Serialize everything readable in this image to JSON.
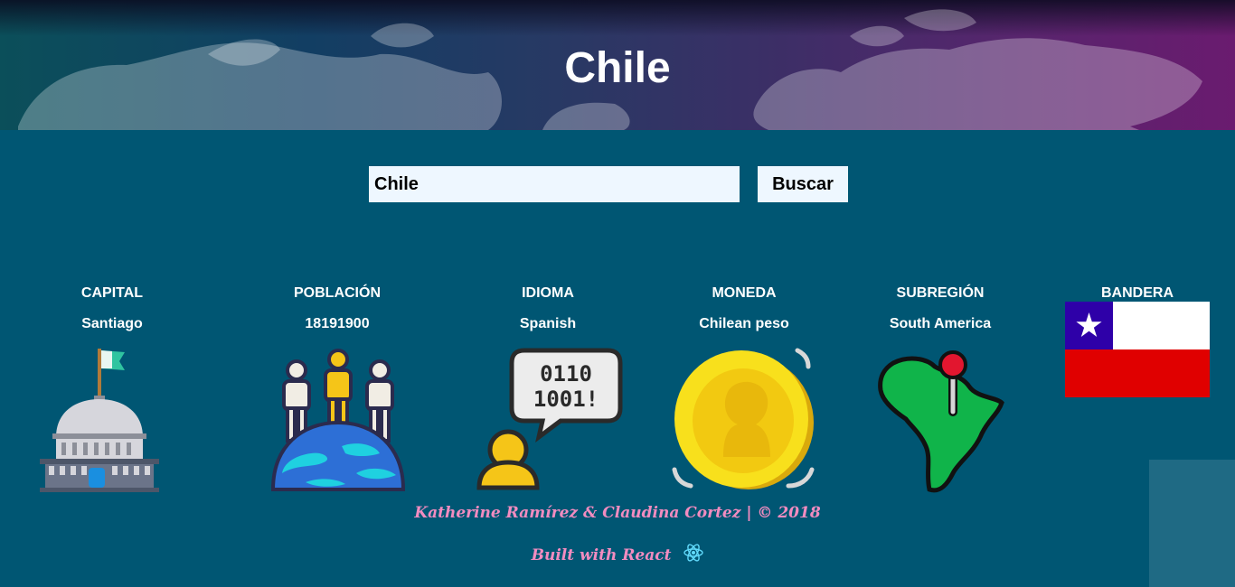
{
  "header": {
    "title": "Chile"
  },
  "search": {
    "value": "Chile",
    "button_label": "Buscar"
  },
  "info": [
    {
      "label": "CAPITAL",
      "value": "Santiago",
      "icon": "capitol-icon"
    },
    {
      "label": "POBLACIÓN",
      "value": "18191900",
      "icon": "population-icon"
    },
    {
      "label": "IDIOMA",
      "value": "Spanish",
      "icon": "language-icon"
    },
    {
      "label": "MONEDA",
      "value": "Chilean peso",
      "icon": "coin-icon"
    },
    {
      "label": "SUBREGIÓN",
      "value": "South America",
      "icon": "map-pin-icon"
    },
    {
      "label": "BANDERA",
      "icon": "chile-flag"
    }
  ],
  "footer": {
    "credits": "Katherine Ramírez & Claudina Cortez | © 2018",
    "built_with": "Built with React"
  },
  "colors": {
    "background": "#005673",
    "footer_text": "#f28cc0",
    "flag_blue": "#2e00a8",
    "flag_red": "#e00000"
  }
}
